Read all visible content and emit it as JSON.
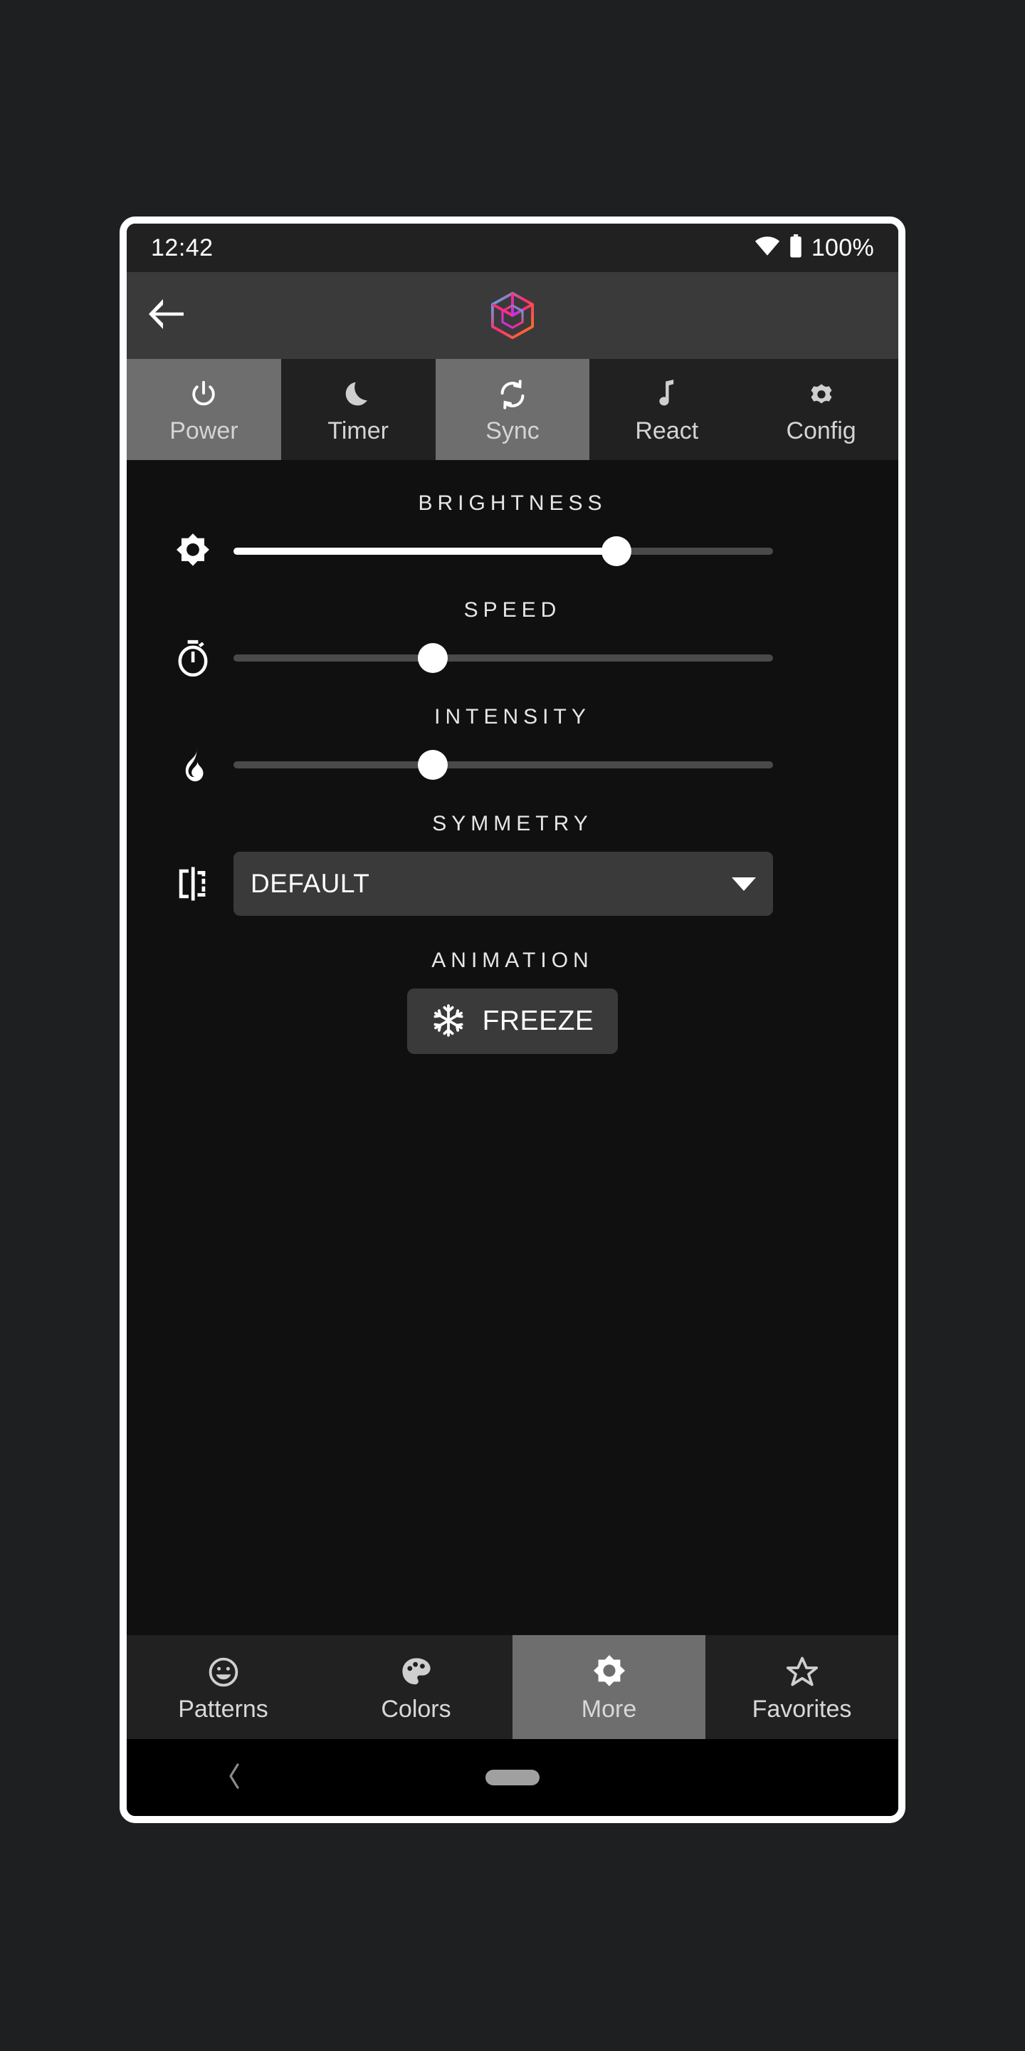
{
  "status_bar": {
    "time": "12:42",
    "wifi_icon": "wifi-icon",
    "battery_icon": "battery-full-icon",
    "battery_percent": "100%"
  },
  "app_bar": {
    "back_icon": "back-arrow-icon",
    "logo_icon": "cube-logo-icon",
    "logo_colors": [
      "#ff7a1a",
      "#ff2d78",
      "#b832ff",
      "#2ec7ff"
    ]
  },
  "top_tabs": [
    {
      "label": "Power",
      "icon": "power-icon",
      "selected": true
    },
    {
      "label": "Timer",
      "icon": "moon-icon",
      "selected": false
    },
    {
      "label": "Sync",
      "icon": "sync-icon",
      "selected": true
    },
    {
      "label": "React",
      "icon": "music-note-icon",
      "selected": false
    },
    {
      "label": "Config",
      "icon": "gear-icon",
      "selected": false
    }
  ],
  "controls": {
    "brightness": {
      "label": "BRIGHTNESS",
      "icon": "brightness-sun-icon",
      "value_percent": 71,
      "min": 0,
      "max": 100,
      "filled": true
    },
    "speed": {
      "label": "SPEED",
      "icon": "stopwatch-icon",
      "value_percent": 37,
      "min": 0,
      "max": 100,
      "filled": false
    },
    "intensity": {
      "label": "INTENSITY",
      "icon": "flame-icon",
      "value_percent": 37,
      "min": 0,
      "max": 100,
      "filled": false
    },
    "symmetry": {
      "label": "SYMMETRY",
      "icon": "mirror-flip-icon",
      "value": "DEFAULT",
      "caret_icon": "chevron-down-icon"
    },
    "animation": {
      "label": "ANIMATION",
      "button_label": "FREEZE",
      "button_icon": "snowflake-icon"
    }
  },
  "bottom_nav": [
    {
      "label": "Patterns",
      "icon": "smiley-face-icon",
      "selected": false
    },
    {
      "label": "Colors",
      "icon": "palette-icon",
      "selected": false
    },
    {
      "label": "More",
      "icon": "brightness-sun-icon",
      "selected": true
    },
    {
      "label": "Favorites",
      "icon": "star-outline-icon",
      "selected": false
    }
  ],
  "system_nav": {
    "back_icon": "system-back-chevron-icon",
    "home_icon": "home-pill-icon"
  },
  "colors": {
    "page_background": "#1e1f21",
    "status_bar": "#212121",
    "app_bar": "#3a3a3a",
    "tab_selected": "#6e6e6e",
    "tab_unselected": "#212121",
    "content_background": "#101010",
    "surface": "#3a3a3a",
    "track": "#4a4a4a",
    "accent": "#ffffff"
  }
}
